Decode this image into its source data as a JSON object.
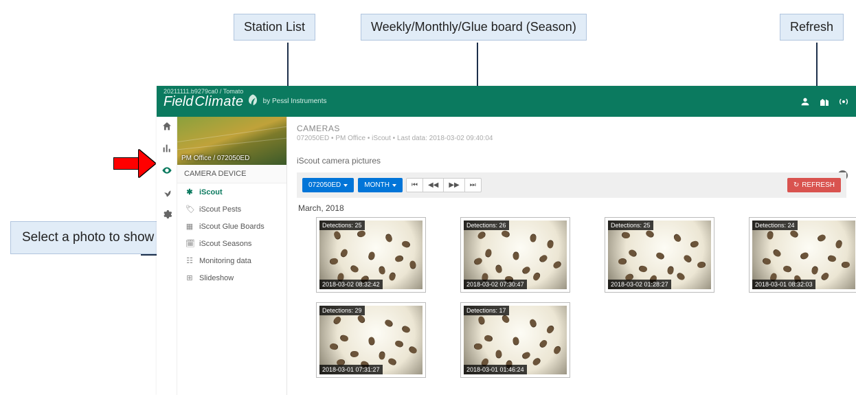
{
  "annotations": {
    "station_list": "Station List",
    "period_selector": "Weekly/Monthly/Glue board (Season)",
    "refresh": "Refresh",
    "select_photo": "Select a photo to show in full-scale."
  },
  "header": {
    "breadcrumb": "20211111.b9279ca0 / Tomato",
    "brand_left": "Field",
    "brand_right": "Climate",
    "brand_sub": "by Pessl Instruments"
  },
  "station": {
    "caption": "PM Office / 072050ED",
    "panel_title": "CAMERA DEVICE",
    "menu": [
      {
        "icon": "✱",
        "label": "iScout",
        "active": true
      },
      {
        "icon": "🏷",
        "label": "iScout Pests"
      },
      {
        "icon": "▦",
        "label": "iScout Glue Boards"
      },
      {
        "icon": "🗓",
        "label": "iScout Seasons"
      },
      {
        "icon": "☷",
        "label": "Monitoring data"
      },
      {
        "icon": "⊞",
        "label": "Slideshow"
      }
    ]
  },
  "page": {
    "heading": "CAMERAS",
    "sub": "072050ED • PM Office • iScout • Last data: 2018-03-02 09:40:04",
    "section": "iScout camera pictures"
  },
  "toolbar": {
    "station_btn": "072050ED",
    "period_btn": "MONTH",
    "refresh_btn": "REFRESH"
  },
  "gallery": {
    "month": "March, 2018",
    "items": [
      {
        "det": "Detections: 25",
        "time": "2018-03-02 08:32:42"
      },
      {
        "det": "Detections: 26",
        "time": "2018-03-02 07:30:47"
      },
      {
        "det": "Detections: 25",
        "time": "2018-03-02 01:28:27"
      },
      {
        "det": "Detections: 24",
        "time": "2018-03-01 08:32:03"
      },
      {
        "det": "Detections: 29",
        "time": "2018-03-01 07:31:27"
      },
      {
        "det": "Detections: 17",
        "time": "2018-03-01 01:46:24"
      }
    ]
  }
}
